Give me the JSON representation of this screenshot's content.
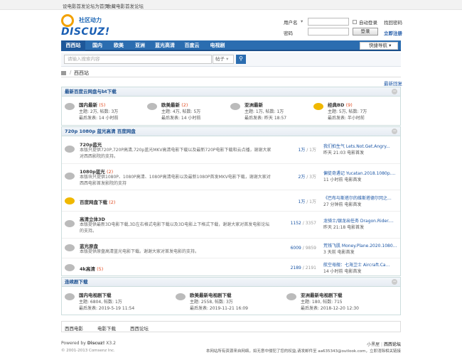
{
  "topbar": {
    "set_home": "设电影首发论坛为首页",
    "bookmark": "收藏电影首发论坛"
  },
  "logo": {
    "cn": "社区动力",
    "en": "DISCUZ!"
  },
  "login": {
    "username_label": "用户名",
    "password_label": "密码",
    "auto_login": "自动登录",
    "forgot": "找回密码",
    "login_button": "登录",
    "register": "立即注册"
  },
  "nav": {
    "items": [
      "西西站",
      "国内",
      "欧美",
      "亚洲",
      "蓝光高清",
      "百度云",
      "电视剧"
    ],
    "quick": "快捷导航"
  },
  "search": {
    "placeholder": "请输入搜索内容",
    "type": "帖子"
  },
  "crumb": {
    "current": "西西站"
  },
  "latest_reply": "最新回复",
  "sections": [
    {
      "title": "最新百度云网盘与bt下载",
      "collapse": "−"
    },
    {
      "title": "720p 1080p 蓝光高清 百度网盘",
      "collapse": "−"
    },
    {
      "title": "连续剧下载",
      "collapse": "−"
    }
  ],
  "grid1": [
    {
      "name": "国内最新",
      "count": "(5)",
      "stats": "主题: 2万, 帖数: 3万",
      "last": "最后发表: 14 小时前"
    },
    {
      "name": "欧美最新",
      "count": "(2)",
      "stats": "主题: 4万, 帖数: 5万",
      "last": "最后发表: 14 小时前"
    },
    {
      "name": "亚洲最新",
      "count": "",
      "stats": "主题: 1万, 帖数: 1万",
      "last": "最后发表: 昨天 18:57"
    },
    {
      "name": "经典BD",
      "count": "(9)",
      "stats": "主题: 5万, 帖数: 7万",
      "last": "最后发表: 半小时前"
    }
  ],
  "rows": [
    {
      "name": "720p蓝光",
      "count": "",
      "desc": "本版只提供720P,720P高清,720p蓝光MKV高清电影下载以及最新720P电影下载和云点播，谢谢大家对西西影院的支持。",
      "threads": "1万",
      "posts": "1万",
      "lp_title": "我们拍生气 Lets.Not.Get.Angry...",
      "lp_meta": "昨天 21:03  电影首发"
    },
    {
      "name": "1080p蓝光",
      "count": "(2)",
      "desc": "本版块只提供1080P、1080P高清、1080P高清电影以及最新1080P首发MKV电影下载，谢谢大家对西西电影首发影院的支持",
      "threads": "2万",
      "posts": "3万",
      "lp_title": "偏徒奇遇记 Yucatan.2018.1080p....",
      "lp_meta": "11 小时前  电影首发"
    },
    {
      "name": "百度网盘下载",
      "count": "(2)",
      "desc": "",
      "threads": "1万",
      "posts": "1万",
      "lp_title": "《巴布与斯塔尔的维斯塔德尔冈之...",
      "lp_meta": "27 分钟前  电影首发"
    },
    {
      "name": "高清立体3D",
      "count": "",
      "desc": "本版提供最新3D电影下载,3D左右格式电影下载以及3D电影上下格式下载，谢谢大家对首发电影论坛的支持。",
      "threads": "1152",
      "posts": "3357",
      "lp_title": "龙骑士/银龙出任务 Dragon.Rider....",
      "lp_meta": "昨天 21:18  电影首发"
    },
    {
      "name": "蓝光原盘",
      "count": "",
      "desc": "本版提供原盘高清蓝光电影下载。谢谢大家对首发电影的支持。",
      "threads": "6009",
      "posts": "9859",
      "lp_title": "荒钱飞肌 Money.Plane.2020.1080...",
      "lp_meta": "3 天前  电影首发"
    },
    {
      "name": "4k高清",
      "count": "(5)",
      "desc": "",
      "threads": "2189",
      "posts": "2191",
      "lp_title": "航空母舰：七海卫士 Aircraft.Ca...",
      "lp_meta": "14 小时前  电影首发"
    }
  ],
  "grid3": [
    {
      "name": "国内电视剧下载",
      "stats": "主题: 6804, 帖数: 1万",
      "last": "最后发表: 2019-5-19 11:54"
    },
    {
      "name": "欧美最新电视剧下载",
      "stats": "主题: 2558, 帖数: 3万",
      "last": "最后发表: 2019-11-21 16:09"
    },
    {
      "name": "亚洲最新电视剧下载",
      "stats": "主题: 180, 帖数: 715",
      "last": "最后发表: 2018-12-20 12:30"
    }
  ],
  "links": [
    "西西电影",
    "电影下载",
    "西西论坛"
  ],
  "footer": {
    "powered": "Powered by",
    "discuz": "Discuz!",
    "version": "X3.2",
    "copyright": "© 2001-2013 Comsenz Inc.",
    "right_links": [
      "小黑屋",
      "西西论坛"
    ],
    "notice": "本网站所有资源来自网络，如无意中侵犯了您的权益,请发邮件至 aa635343@outlook.com，立即消除相关链接"
  }
}
